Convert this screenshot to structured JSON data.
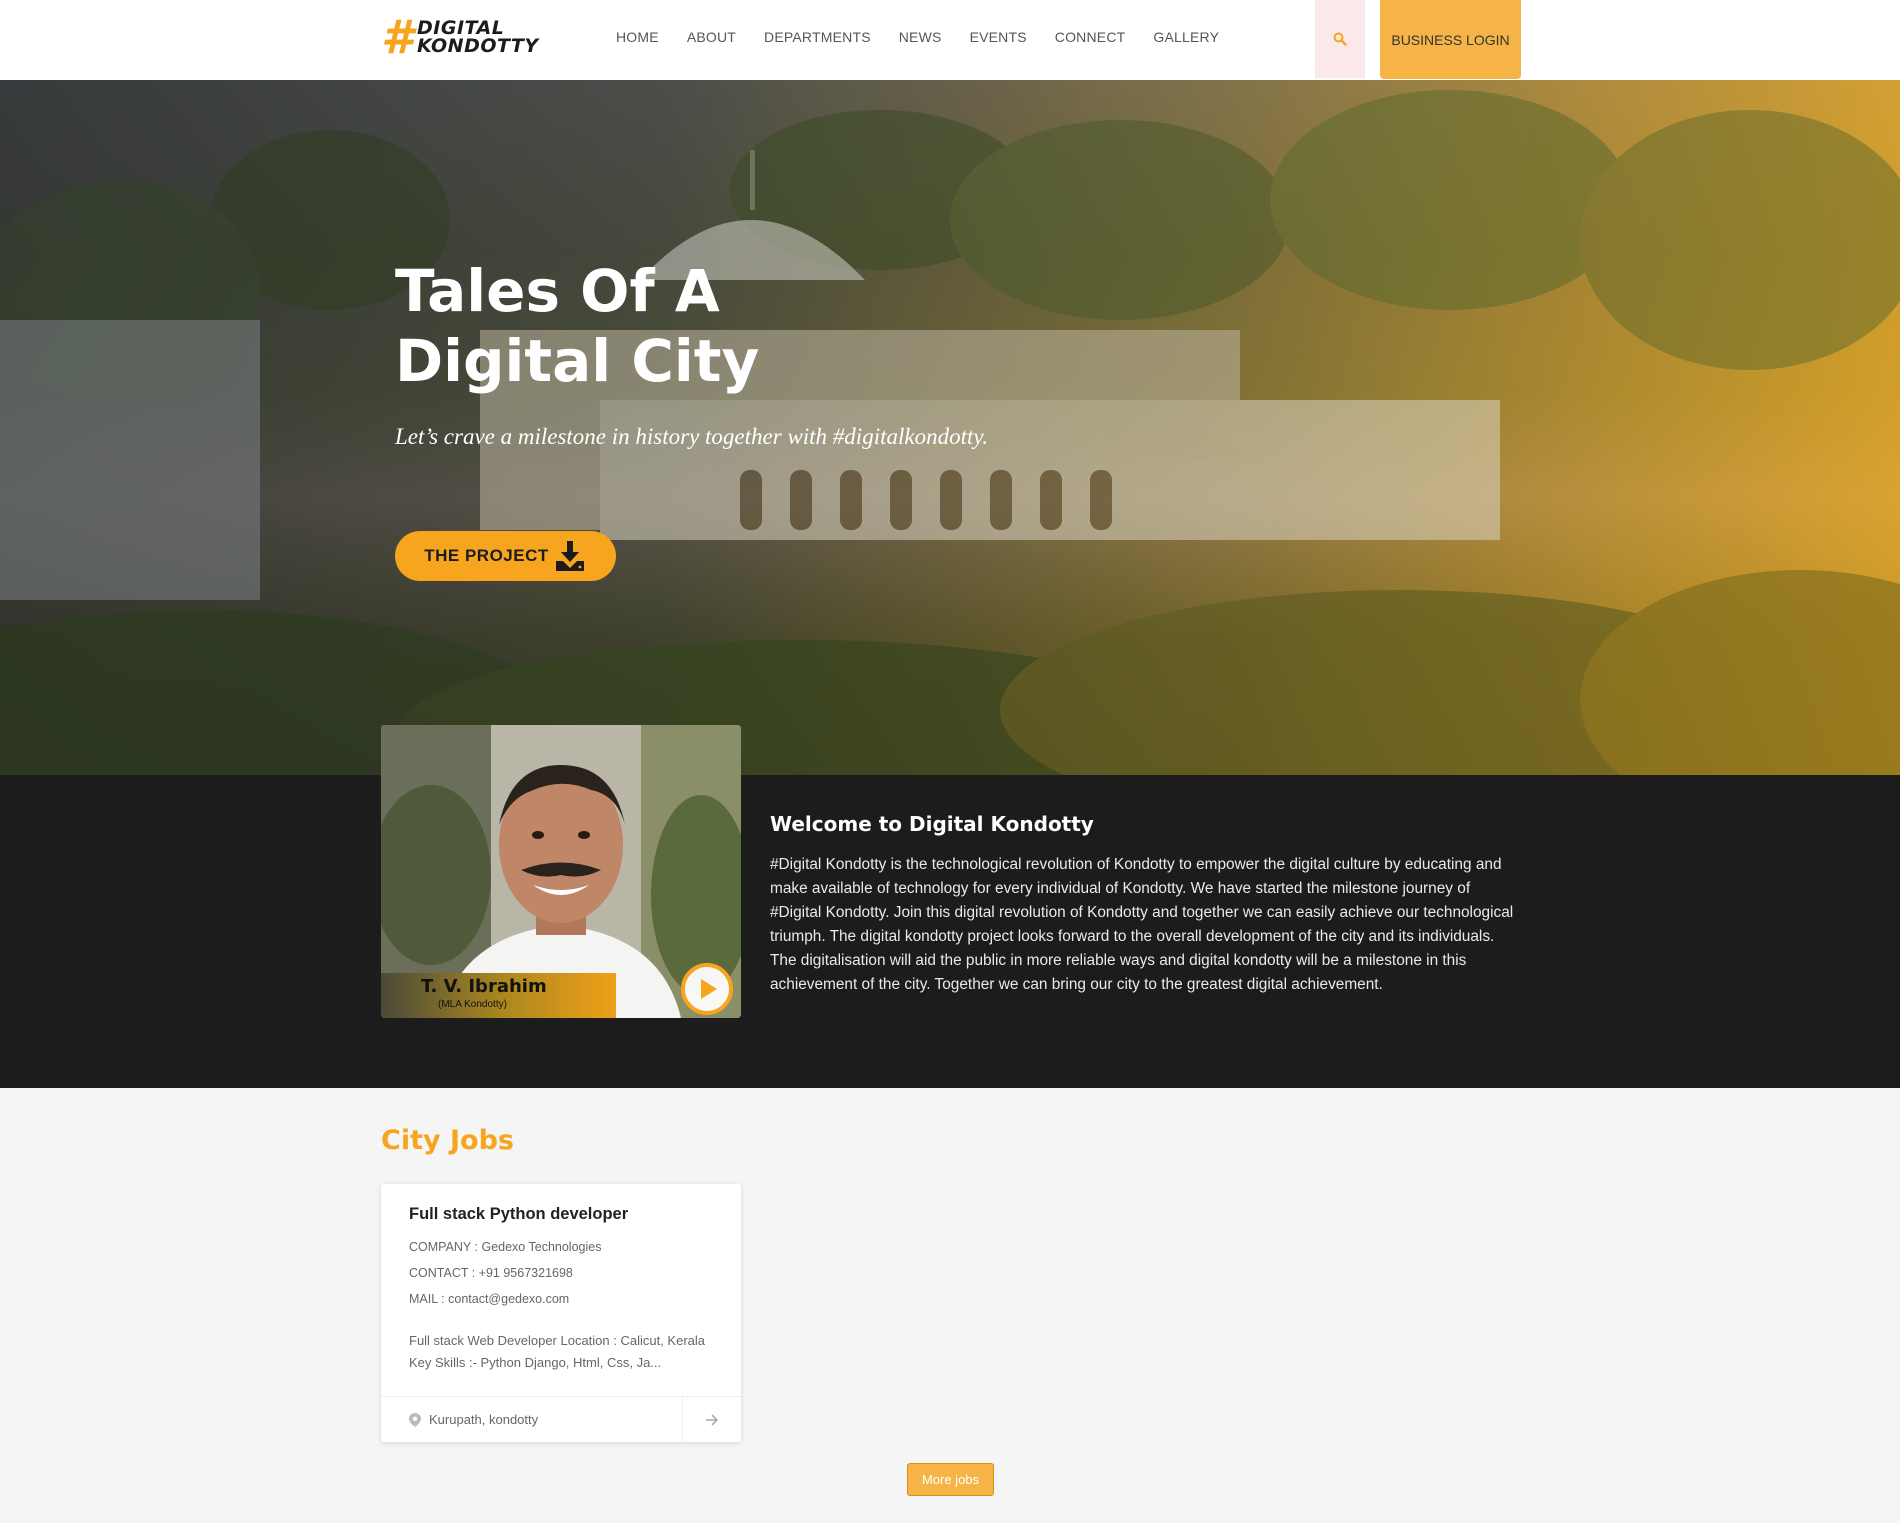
{
  "header": {
    "logo_line1": "DIGITAL",
    "logo_line2": "KONDOTTY",
    "nav": [
      "HOME",
      "ABOUT",
      "DEPARTMENTS",
      "NEWS",
      "EVENTS",
      "CONNECT",
      "GALLERY"
    ],
    "business_login": "BUSINESS LOGIN"
  },
  "hero": {
    "title_line1": "Tales Of A",
    "title_line2": "Digital City",
    "subtitle": "Let’s crave a milestone in history together with #digitalkondotty.",
    "button": "THE PROJECT"
  },
  "mla": {
    "name": "T. V. Ibrahim",
    "role": "(MLA Kondotty)"
  },
  "welcome": {
    "title": "Welcome to Digital Kondotty",
    "text": "#Digital Kondotty is the technological revolution of Kondotty to empower the digital culture by educating and make available of technology for every individual of Kondotty. We have started the milestone journey of #Digital Kondotty. Join this digital revolution of Kondotty and together we can easily achieve our technological triumph. The digital kondotty project looks forward to the overall development of the city and its individuals. The digitalisation will aid the public in more reliable ways and digital kondotty will be a milestone in this achievement of the city. Together we can bring our city to the greatest digital achievement."
  },
  "jobs": {
    "section_title": "City Jobs",
    "items": [
      {
        "title": "Full stack Python developer",
        "company": "COMPANY : Gedexo Technologies",
        "contact": "CONTACT : +91 9567321698",
        "mail": "MAIL : contact@gedexo.com",
        "description": "Full stack Web Developer Location : Calicut, Kerala Key Skills :- Python Django, Html, Css, Ja...",
        "location": "Kurupath, kondotty"
      }
    ],
    "more_button": "More jobs"
  },
  "colors": {
    "accent": "#f7a51e",
    "dark": "#1c1c1c"
  }
}
